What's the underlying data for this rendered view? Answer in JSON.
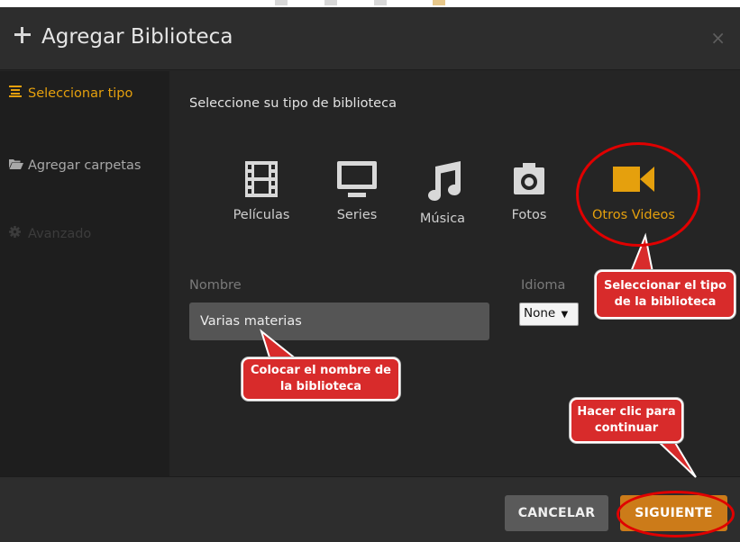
{
  "dialog": {
    "title": "Agregar Biblioteca",
    "close_glyph": "×"
  },
  "sidebar": {
    "items": [
      {
        "label": "Seleccionar tipo",
        "icon": "list-icon",
        "state": "active"
      },
      {
        "label": "Agregar carpetas",
        "icon": "folder-open-icon",
        "state": "normal"
      },
      {
        "label": "Avanzado",
        "icon": "gear-icon",
        "state": "disabled"
      }
    ]
  },
  "main": {
    "prompt": "Seleccione su tipo de biblioteca",
    "types": [
      {
        "label": "Películas",
        "icon": "film-icon",
        "selected": false
      },
      {
        "label": "Series",
        "icon": "monitor-icon",
        "selected": false
      },
      {
        "label": "Música",
        "icon": "music-note-icon",
        "selected": false
      },
      {
        "label": "Fotos",
        "icon": "camera-icon",
        "selected": false
      },
      {
        "label": "Otros Videos",
        "icon": "video-camera-icon",
        "selected": true
      }
    ],
    "name_label": "Nombre",
    "name_value": "Varias materias",
    "language_label": "Idioma",
    "language_value": "None"
  },
  "footer": {
    "cancel_label": "CANCELAR",
    "next_label": "SIGUIENTE"
  },
  "annotations": {
    "type_callout": "Seleccionar el tipo de la biblioteca",
    "name_callout": "Colocar el nombre de la biblioteca",
    "next_callout": "Hacer clic para continuar"
  },
  "colors": {
    "accent": "#e5a00d",
    "next_button": "#cc7b19",
    "annotation_red": "#d82b2b"
  }
}
